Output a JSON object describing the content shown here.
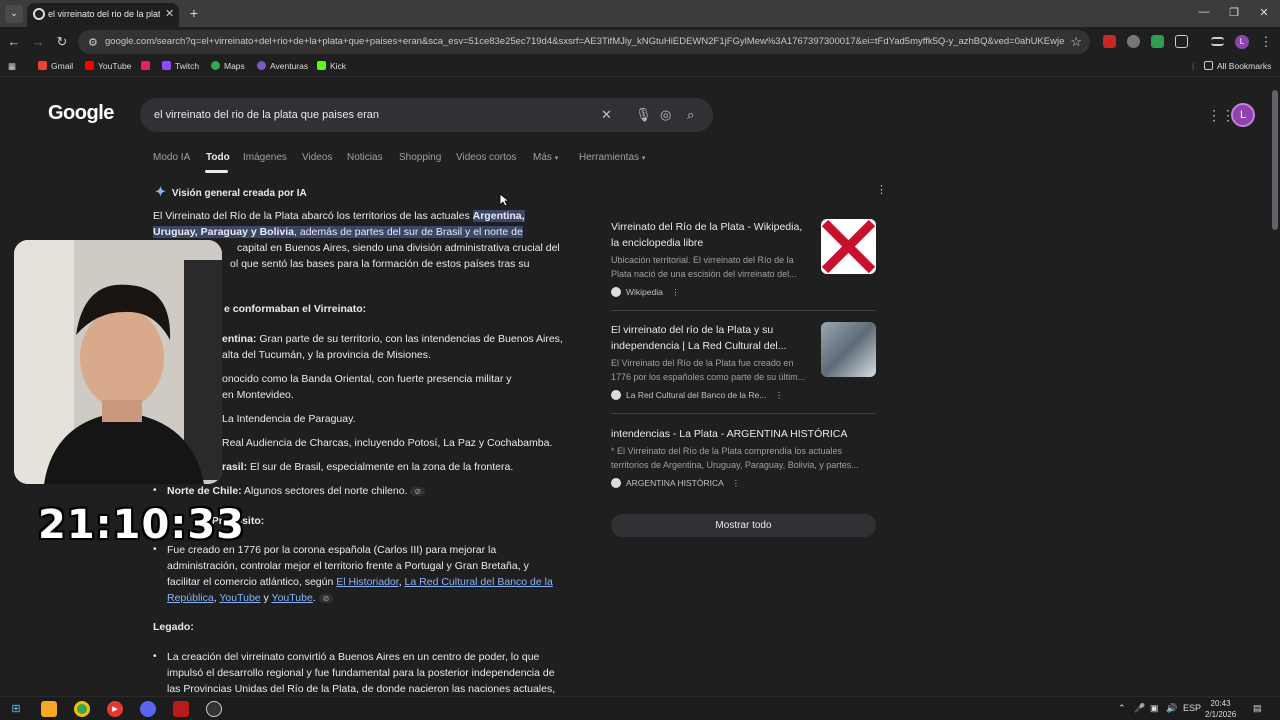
{
  "browser": {
    "tab_title": "el virreinato del rio de la plata q",
    "url": "google.com/search?q=el+virreinato+del+rio+de+la+plata+que+paises+eran&sca_esv=51ce83e25ec719d4&sxsrf=AE3TifMJiy_kNGtuHiEDEWN2F1jFGylMew%3A1767397300017&ei=tFdYad5myffk5Q-y_azhBQ&ved=0ahUKEwjek Pq..."
  },
  "bookmarks": {
    "items": [
      "Gmail",
      "YouTube",
      "Twitch",
      "Maps",
      "Aventuras",
      "Kick"
    ],
    "all": "All Bookmarks"
  },
  "google": {
    "logo": "Google",
    "query": "el virreinato del rio de la plata que paises eran",
    "tabs": [
      "Modo IA",
      "Todo",
      "Imágenes",
      "Videos",
      "Noticias",
      "Shopping",
      "Videos cortos",
      "Más",
      "Herramientas"
    ],
    "profile_initial": "L"
  },
  "ai": {
    "header": "Visión general creada por IA",
    "intro_1a": "El Virreinato del Río de la Plata abarcó los territorios de las actuales ",
    "intro_1b": "Argentina,",
    "intro_2a": "Uruguay, Paraguay y Bolivia",
    "intro_2b": ", además de partes del sur de Brasil",
    "intro_2c": " y el norte de",
    "intro_3": "capital en Buenos Aires, siendo una división administrativa crucial del",
    "intro_4": "ol que sentó las bases para la formación de estos países tras su",
    "section1": "e conformaban el Virreinato:",
    "arg_label": "entina:",
    "arg_text": " Gran parte de su territorio, con las intendencias de Buenos Aires,",
    "arg_text2": "alta del Tucumán, y la provincia de Misiones.",
    "uru_text": "onocido como la Banda Oriental, con fuerte presencia militar y",
    "uru_text2": "en Montevideo.",
    "par_text": "La Intendencia de Paraguay.",
    "bol_text": "Real Audiencia de Charcas, incluyendo Potosí, La Paz y Cochabamba.",
    "bra_label": "rasil:",
    "bra_text": " El sur de Brasil, especialmente en la zona de la frontera.",
    "chi_label": "Norte de Chile:",
    "chi_text": " Algunos sectores del norte chileno.",
    "section2": "y Propósito:",
    "prop_1": "Fue creado en 1776 por la corona española (Carlos III) para mejorar la",
    "prop_2": "administración, controlar mejor el territorio frente a Portugal y Gran Bretaña, y",
    "prop_3a": "facilitar el comercio atlántico, según ",
    "prop_link1": "El Historiador",
    "prop_comma": ", ",
    "prop_link2": "La Red Cultural del Banco de la",
    "prop_link3": "República",
    "prop_sep": ", ",
    "prop_link4": "YouTube",
    "prop_y": " y ",
    "prop_link5": "YouTube",
    "prop_end": ".",
    "section3": "Legado:",
    "leg_1": "La creación del virreinato convirtió a Buenos Aires en un centro de poder, lo que",
    "leg_2": "impulsó el desarrollo regional y fue fundamental para la posterior independencia de",
    "leg_3": "las Provincias Unidas del Río de la Plata, de donde nacieron las naciones actuales,"
  },
  "sources": [
    {
      "title_1": "Virreinato del Río de la Plata - Wikipedia,",
      "title_2": "la enciclopedia libre",
      "desc_1": "Ubicación territorial. El virreinato del Río de la",
      "desc_2": "Plata nació de una escisión del virreinato del...",
      "site": "Wikipedia"
    },
    {
      "title_1": "El virreinato del río de la Plata y su",
      "title_2": "independencia | La Red Cultural del...",
      "desc_1": "El Virreinato del Río de la Plata fue creado en",
      "desc_2": "1776 por los españoles como parte de su últim...",
      "site": "La Red Cultural del Banco de la Re..."
    },
    {
      "title_1": "intendencias - La Plata - ARGENTINA HISTÓRICA",
      "title_2": "",
      "desc_1": "* El Virreinato del Río de la Plata comprendía los actuales",
      "desc_2": "territorios de Argentina, Uruguay, Paraguay, Bolivia, y partes...",
      "site": "ARGENTINA HISTÓRICA"
    }
  ],
  "show_all": "Mostrar todo",
  "overlay": {
    "timer": "21:10:33"
  },
  "taskbar": {
    "lang": "ESP",
    "time": "20:43",
    "date": "2/1/2026"
  }
}
